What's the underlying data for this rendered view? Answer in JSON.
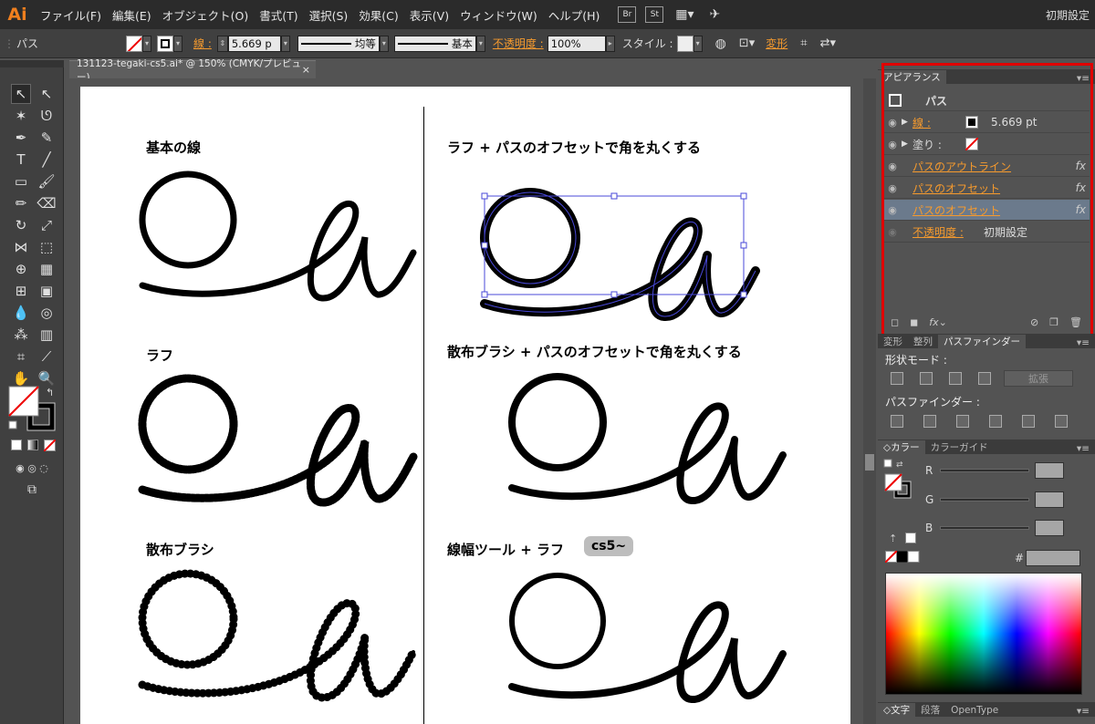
{
  "app": {
    "logo": "Ai",
    "preset": "初期設定"
  },
  "menubar": {
    "items": [
      "ファイル(F)",
      "編集(E)",
      "オブジェクト(O)",
      "書式(T)",
      "選択(S)",
      "効果(C)",
      "表示(V)",
      "ウィンドウ(W)",
      "ヘルプ(H)"
    ],
    "bridge": "Br",
    "stock": "St"
  },
  "controlbar": {
    "object_type": "パス",
    "stroke_label": "線 :",
    "stroke_weight": "5.669 p",
    "profile": "均等",
    "brush": "基本",
    "opacity_label": "不透明度 :",
    "opacity_value": "100%",
    "style_label": "スタイル :",
    "transform": "変形"
  },
  "document": {
    "tab_title": "131123-tegaki-cs5.ai* @ 150% (CMYK/プレビュー)",
    "close": "×"
  },
  "artboard": {
    "labels": {
      "basic": "基本の線",
      "rough": "ラフ",
      "scatter": "散布ブラシ",
      "rough_offset": "ラフ + パスのオフセットで角を丸くする",
      "scatter_offset": "散布ブラシ + パスのオフセットで角を丸くする",
      "width_rough": "線幅ツール + ラフ"
    },
    "badge": "cs5~"
  },
  "appearance": {
    "tab": "アピアランス",
    "title": "パス",
    "rows": [
      {
        "label": "線 :",
        "value": "5.669 pt"
      },
      {
        "label": "塗り :"
      },
      {
        "label": "パスのアウトライン",
        "fx": "fx"
      },
      {
        "label": "パスのオフセット",
        "fx": "fx"
      },
      {
        "label": "パスのオフセット",
        "fx": "fx"
      },
      {
        "label": "不透明度 :",
        "value": "初期設定"
      }
    ]
  },
  "pathfinder": {
    "tabs": [
      "変形",
      "整列",
      "パスファインダー"
    ],
    "shape_modes": "形状モード :",
    "expand": "拡張",
    "pathfinders": "パスファインダー :"
  },
  "color": {
    "tabs": [
      "カラー",
      "カラーガイド"
    ],
    "channels": [
      "R",
      "G",
      "B"
    ],
    "hex_label": "#"
  },
  "type_panel": {
    "tabs": [
      "文字",
      "段落",
      "OpenType"
    ]
  },
  "colors": {
    "accent": "#f59a2e",
    "highlight": "#e00000",
    "selection": "#4848d8"
  }
}
